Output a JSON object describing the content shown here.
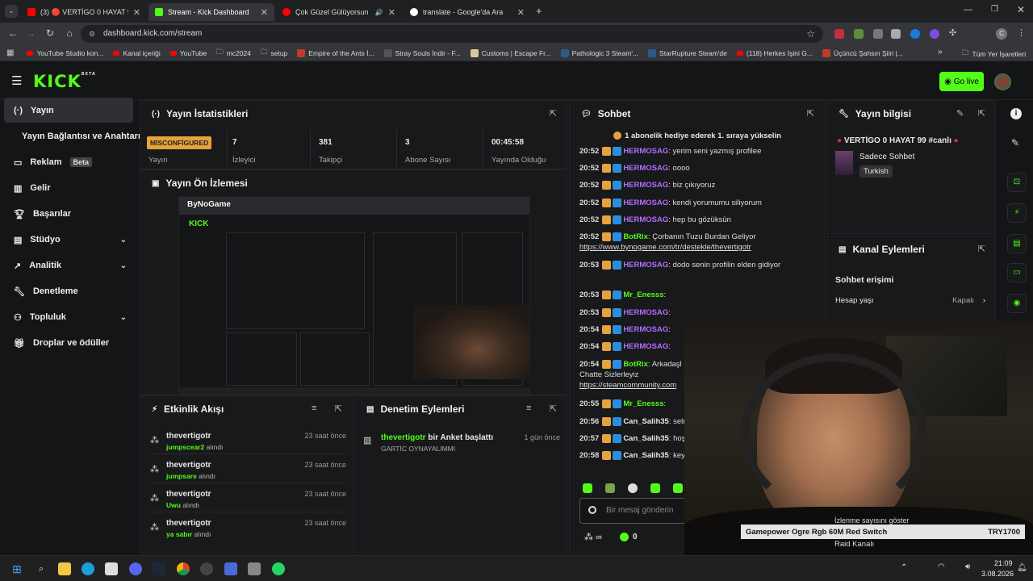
{
  "browser": {
    "tabs": [
      {
        "label": "(3) 🔴 VERTİGO 0 HAYAT 99 #c",
        "active": false,
        "color": "#ff0000"
      },
      {
        "label": "Stream - Kick Dashboard",
        "active": true,
        "color": "#53fc18"
      },
      {
        "label": "Çok Güzel Gülüyorsun | You",
        "active": false,
        "color": "#ff0000"
      },
      {
        "label": "translate - Google'da Ara",
        "active": false,
        "color": "#4285f4"
      }
    ],
    "url": "dashboard.kick.com/stream",
    "bookmarks": [
      "YouTube Studio kon...",
      "Kanal içeriği",
      "YouTube",
      "mc2024",
      "setup",
      "Empire of the Ants İ...",
      "Stray Souls İndir - F...",
      "Customs | Escape Fr...",
      "Pathologic 3 Steam'...",
      "StarRupture Steam'de",
      "(118) Herkes İşini G...",
      "Üçüncü Şahsın Şiiri |..."
    ],
    "all_bookmarks": "Tüm Yer İşaretleri"
  },
  "header": {
    "logo": "KICK",
    "logo_sup": "BETA",
    "go_live": "Go live"
  },
  "sidebar": {
    "items": [
      {
        "label": "Yayın",
        "active": true
      },
      {
        "label": "Yayın Bağlantısı ve Anahtarı"
      },
      {
        "label": "Reklam",
        "badge": "Beta"
      },
      {
        "label": "Gelir"
      },
      {
        "label": "Başarılar"
      },
      {
        "label": "Stüdyo"
      },
      {
        "label": "Analitik"
      },
      {
        "label": "Denetleme"
      },
      {
        "label": "Topluluk"
      },
      {
        "label": "Droplar ve ödüller"
      }
    ]
  },
  "stats": {
    "title": "Yayın İstatistikleri",
    "status_badge": "MİSCONFİGURED",
    "status_label": "Yayın",
    "viewers": {
      "value": "7",
      "label": "İzleyici"
    },
    "followers": {
      "value": "381",
      "label": "Takipçi"
    },
    "subs": {
      "value": "3",
      "label": "Abone Sayısı"
    },
    "uptime": {
      "value": "00:45:58",
      "label": "Yayında Olduğu"
    }
  },
  "preview": {
    "title": "Yayın Ön İzlemesi",
    "watermark": "ByNoGame"
  },
  "activity": {
    "title": "Etkinlik Akışı",
    "items": [
      {
        "user": "thevertigotr",
        "time": "23 saat önce",
        "item": "jumpscear2",
        "suffix": "alındı"
      },
      {
        "user": "thevertigotr",
        "time": "23 saat önce",
        "item": "jumpsare",
        "suffix": "alındı"
      },
      {
        "user": "thevertigotr",
        "time": "23 saat önce",
        "item": "Uwu",
        "suffix": "alındı"
      },
      {
        "user": "thevertigotr",
        "time": "23 saat önce",
        "item": "ya sabır",
        "suffix": "alındı"
      }
    ]
  },
  "moderation": {
    "title": "Denetim Eylemleri",
    "items": [
      {
        "user": "thevertigotr",
        "action": "bir Anket başlattı",
        "time": "1 gün önce",
        "detail": "GARTİC OYNAYALIMMI"
      }
    ]
  },
  "chat": {
    "title": "Sohbet",
    "pinned": "1 abonelik hediye ederek 1. sıraya yükselin",
    "messages": [
      {
        "time": "20:52",
        "user": "HERMOSAG",
        "text": "yerim seni yazmış profilee",
        "color": "#b36bff"
      },
      {
        "time": "20:52",
        "user": "HERMOSAG",
        "text": "oooo",
        "color": "#b36bff"
      },
      {
        "time": "20:52",
        "user": "HERMOSAG",
        "text": "biz çıkıyoruz",
        "color": "#b36bff"
      },
      {
        "time": "20:52",
        "user": "HERMOSAG",
        "text": "kendi yorumumu siliyorum",
        "color": "#b36bff"
      },
      {
        "time": "20:52",
        "user": "HERMOSAG",
        "text": "hep bu gözüksün",
        "color": "#b36bff"
      },
      {
        "time": "20:52",
        "user": "BotRix",
        "text": "Çorbanın Tuzu Burdan Geliyor",
        "link": "https://www.bynogame.com/tr/destekle/thevertigotr",
        "color": "#53fc18"
      },
      {
        "time": "20:53",
        "user": "HERMOSAG",
        "text": "dodo senin profilin elden gidiyor",
        "color": "#b36bff"
      },
      {
        "time": "20:53",
        "user": "Mr_Enesss",
        "text": "",
        "color": "#53fc18"
      },
      {
        "time": "20:53",
        "user": "HERMOSAG",
        "text": "",
        "color": "#b36bff"
      },
      {
        "time": "20:54",
        "user": "HERMOSAG",
        "text": "",
        "color": "#b36bff"
      },
      {
        "time": "20:54",
        "user": "HERMOSAG",
        "text": "",
        "color": "#b36bff"
      },
      {
        "time": "20:54",
        "user": "BotRix",
        "text": "Arkadaşl",
        "text2": "Chatte Sizlerleyiz",
        "link": "https://steamcommunity.com",
        "color": "#53fc18"
      },
      {
        "time": "20:55",
        "user": "Mr_Enesss",
        "text": "",
        "color": "#53fc18"
      },
      {
        "time": "20:56",
        "user": "Can_Salih35",
        "text": "selmalar i",
        "color": "#e8e8e8"
      },
      {
        "time": "20:57",
        "user": "Can_Salih35",
        "text": "hoş buldu",
        "color": "#e8e8e8"
      },
      {
        "time": "20:58",
        "user": "Can_Salih35",
        "text": "keyifler na",
        "color": "#e8e8e8"
      }
    ],
    "input_placeholder": "Bir mesaj gönderin",
    "points": "0"
  },
  "stream_info": {
    "title": "Yayın bilgisi",
    "stream_title": "VERTİGO 0 HAYAT 99 #canlı",
    "category": "Sadece Sohbet",
    "tag": "Turkish"
  },
  "channel_actions": {
    "title": "Kanal Eylemleri",
    "section": "Sohbet erişimi",
    "account_age_label": "Hesap yaşı",
    "account_age_value": "Kapalı",
    "show_views": "İzlenme sayısını göster",
    "raid": "Raid Kanalı"
  },
  "overlay": {
    "product": "Gamepower Ogre Rgb 60M Red Switch",
    "price": "TRY1700"
  },
  "taskbar": {
    "time": "21:09",
    "date": "3.08.2026"
  },
  "colors": {
    "accent": "#53fc18",
    "panel": "#18191b",
    "bg": "#141517",
    "warning": "#e9a23b"
  }
}
